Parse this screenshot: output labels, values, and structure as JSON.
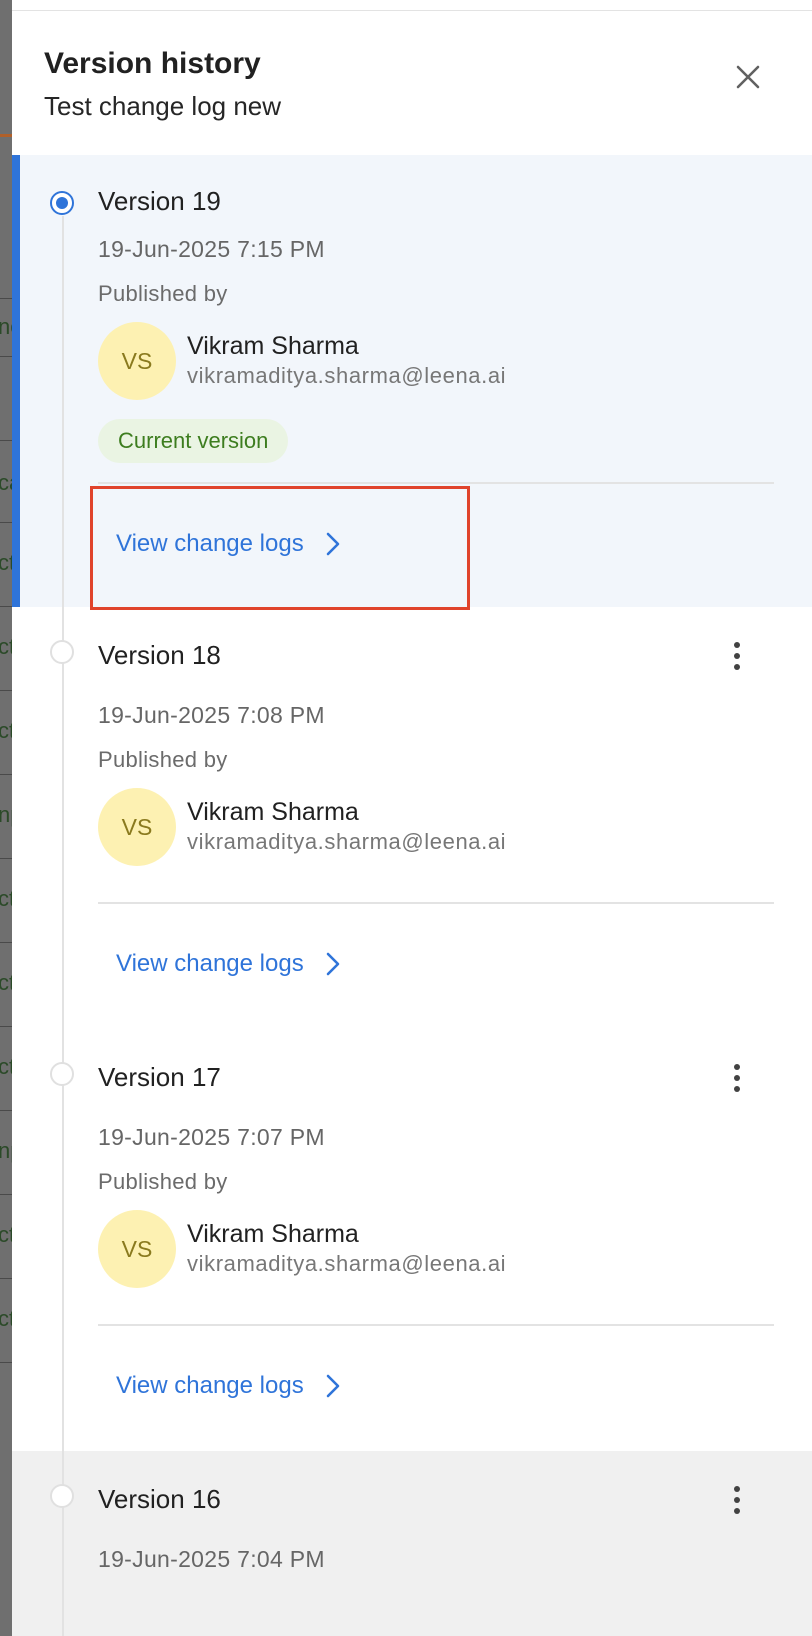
{
  "panel": {
    "title": "Version history",
    "subtitle": "Test change log new"
  },
  "background": {
    "edge_fragments": [
      "nc",
      "ca",
      "ct",
      "ct",
      "ct",
      "np",
      "ct",
      "ct",
      "ct",
      "np",
      "ct",
      "ct"
    ]
  },
  "versions": [
    {
      "title": "Version 19",
      "date": "19-Jun-2025 7:15 PM",
      "published_by_label": "Published by",
      "initials": "VS",
      "name": "Vikram Sharma",
      "email": "vikramaditya.sharma@leena.ai",
      "badge": "Current version",
      "link": "View change logs",
      "selected": true
    },
    {
      "title": "Version 18",
      "date": "19-Jun-2025 7:08 PM",
      "published_by_label": "Published by",
      "initials": "VS",
      "name": "Vikram Sharma",
      "email": "vikramaditya.sharma@leena.ai",
      "link": "View change logs"
    },
    {
      "title": "Version 17",
      "date": "19-Jun-2025 7:07 PM",
      "published_by_label": "Published by",
      "initials": "VS",
      "name": "Vikram Sharma",
      "email": "vikramaditya.sharma@leena.ai",
      "link": "View change logs"
    },
    {
      "title": "Version 16",
      "date": "19-Jun-2025 7:04 PM"
    }
  ],
  "colors": {
    "accent": "#2f74d9",
    "selected_bg": "#f2f6fb",
    "avatar_bg": "#fdf1b2",
    "badge_bg": "#eaf4e3",
    "badge_text": "#3d7d1f",
    "highlight": "#e0432b"
  },
  "icons": {
    "close": "close-icon",
    "link_arrow": "chevron-right-icon",
    "menu": "more-vertical-icon"
  }
}
